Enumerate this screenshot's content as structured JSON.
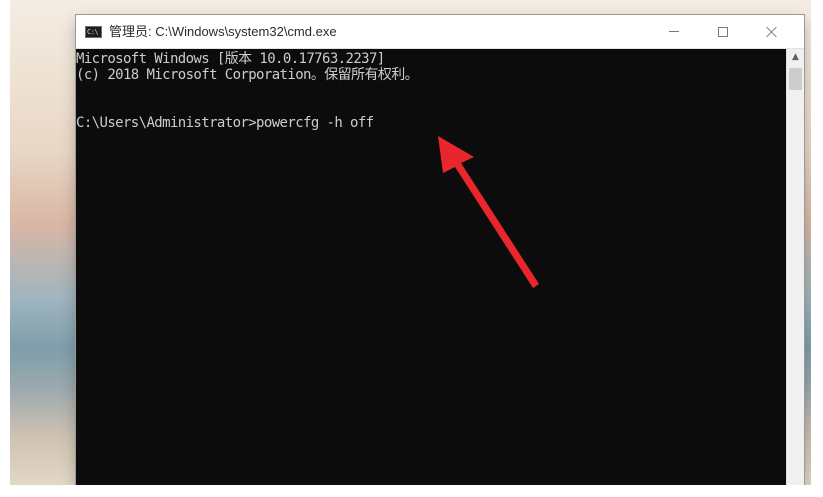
{
  "window": {
    "title": "管理员: C:\\Windows\\system32\\cmd.exe",
    "icon_label": "C:\\",
    "controls": {
      "minimize": "minimize-icon",
      "maximize": "maximize-icon",
      "close": "close-icon"
    }
  },
  "console": {
    "lines": [
      "Microsoft Windows [版本 10.0.17763.2237]",
      "(c) 2018 Microsoft Corporation。保留所有权利。",
      "C:\\Users\\Administrator>powercfg -h off"
    ]
  },
  "scrollbar": {
    "up_arrow": "▲"
  },
  "annotation": {
    "arrow_color": "#e8262b",
    "arrow_icon": "red-arrow-icon"
  },
  "colors": {
    "console_bg": "#0c0c0c",
    "console_text": "#cccccc",
    "titlebar_bg": "#ffffff"
  }
}
